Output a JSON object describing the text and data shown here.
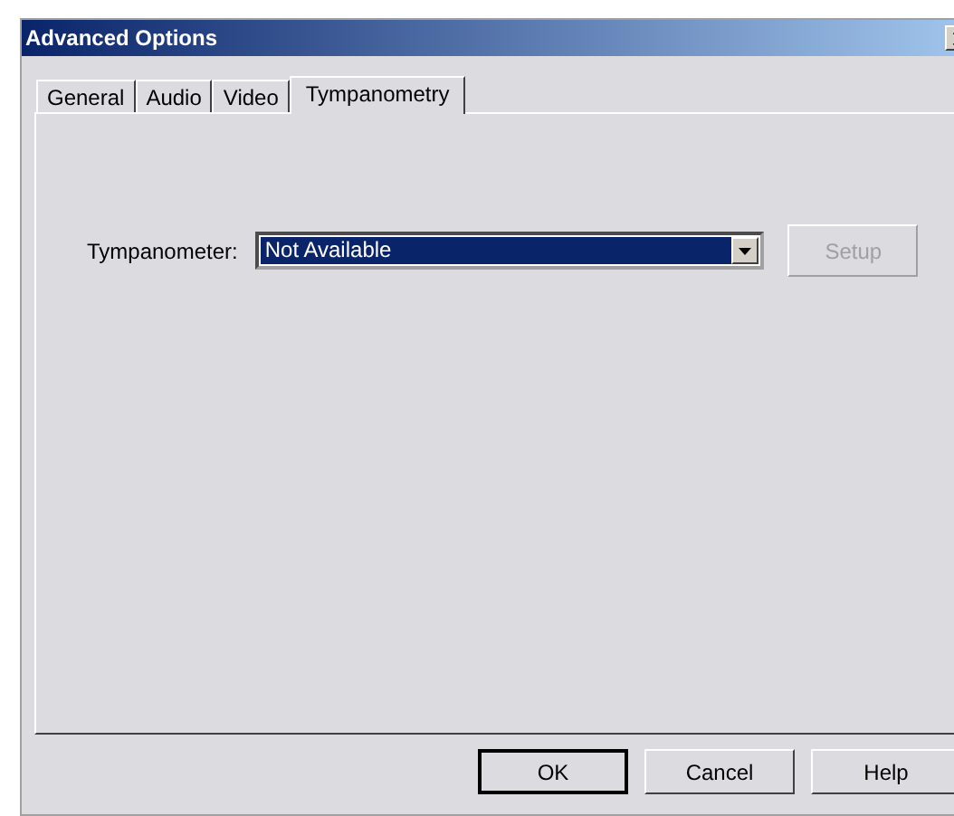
{
  "window": {
    "title": "Advanced Options"
  },
  "tabs": [
    {
      "label": "General",
      "selected": false
    },
    {
      "label": "Audio",
      "selected": false
    },
    {
      "label": "Video",
      "selected": false
    },
    {
      "label": "Tympanometry",
      "selected": true
    }
  ],
  "tympanometer": {
    "label": "Tympanometer:",
    "value": "Not Available",
    "focused": true
  },
  "setup_button": {
    "label": "Setup",
    "disabled": true
  },
  "buttons": [
    {
      "label": "OK",
      "default": true
    },
    {
      "label": "Cancel",
      "default": false
    },
    {
      "label": "Help",
      "default": false
    }
  ]
}
